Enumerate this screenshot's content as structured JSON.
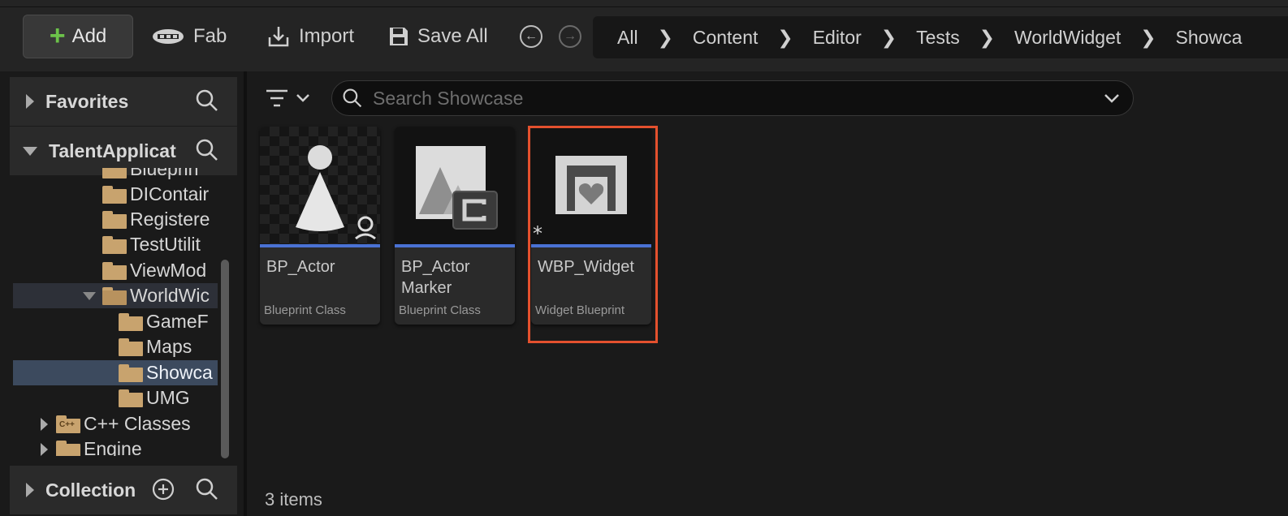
{
  "toolbar": {
    "add_label": "Add",
    "fab_label": "Fab",
    "import_label": "Import",
    "save_all_label": "Save All"
  },
  "breadcrumb": [
    "All",
    "Content",
    "Editor",
    "Tests",
    "WorldWidget",
    "Showca"
  ],
  "sidebar": {
    "favorites_label": "Favorites",
    "project_label": "TalentApplicat",
    "collection_label": "Collection",
    "tree": [
      {
        "label": "Blueprin"
      },
      {
        "label": "DIContair"
      },
      {
        "label": "Registere"
      },
      {
        "label": "TestUtilit"
      },
      {
        "label": "ViewMod"
      },
      {
        "label": "WorldWic"
      },
      {
        "label": "GameF"
      },
      {
        "label": "Maps"
      },
      {
        "label": "Showca"
      },
      {
        "label": "UMG"
      },
      {
        "label": "C++ Classes"
      },
      {
        "label": "Engine"
      }
    ]
  },
  "search": {
    "placeholder": "Search Showcase",
    "value": ""
  },
  "assets": [
    {
      "name": "BP_Actor",
      "type": "Blueprint Class"
    },
    {
      "name": "BP_Actor Marker",
      "type": "Blueprint Class"
    },
    {
      "name": "WBP_Widget",
      "type": "Widget Blueprint"
    }
  ],
  "status": {
    "item_count": "3 items"
  },
  "colors": {
    "accent_blue": "#4a72d4",
    "highlight": "#e4512e",
    "folder": "#c8a36e",
    "add_green": "#6cc24a"
  }
}
